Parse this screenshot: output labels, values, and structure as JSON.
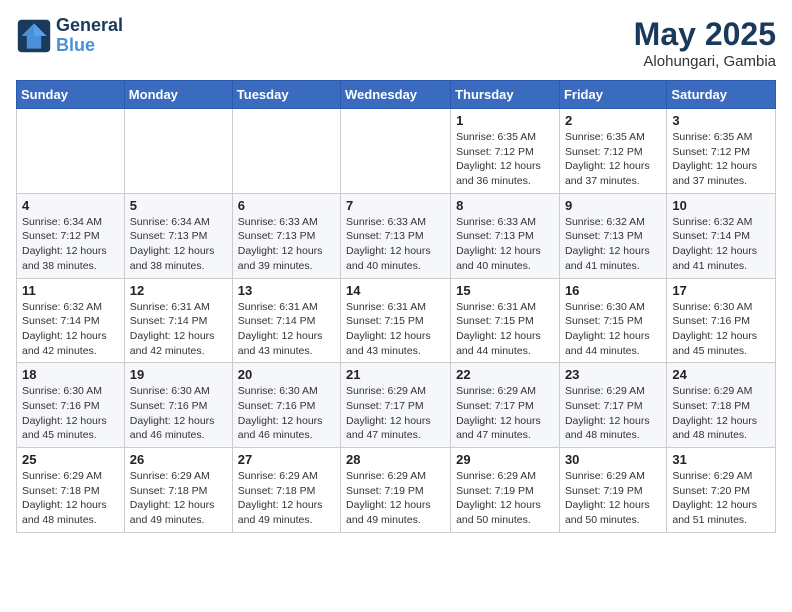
{
  "header": {
    "logo_line1": "General",
    "logo_line2": "Blue",
    "month_year": "May 2025",
    "location": "Alohungari, Gambia"
  },
  "days_of_week": [
    "Sunday",
    "Monday",
    "Tuesday",
    "Wednesday",
    "Thursday",
    "Friday",
    "Saturday"
  ],
  "weeks": [
    [
      {
        "day": "",
        "detail": ""
      },
      {
        "day": "",
        "detail": ""
      },
      {
        "day": "",
        "detail": ""
      },
      {
        "day": "",
        "detail": ""
      },
      {
        "day": "1",
        "detail": "Sunrise: 6:35 AM\nSunset: 7:12 PM\nDaylight: 12 hours and 36 minutes."
      },
      {
        "day": "2",
        "detail": "Sunrise: 6:35 AM\nSunset: 7:12 PM\nDaylight: 12 hours and 37 minutes."
      },
      {
        "day": "3",
        "detail": "Sunrise: 6:35 AM\nSunset: 7:12 PM\nDaylight: 12 hours and 37 minutes."
      }
    ],
    [
      {
        "day": "4",
        "detail": "Sunrise: 6:34 AM\nSunset: 7:12 PM\nDaylight: 12 hours and 38 minutes."
      },
      {
        "day": "5",
        "detail": "Sunrise: 6:34 AM\nSunset: 7:13 PM\nDaylight: 12 hours and 38 minutes."
      },
      {
        "day": "6",
        "detail": "Sunrise: 6:33 AM\nSunset: 7:13 PM\nDaylight: 12 hours and 39 minutes."
      },
      {
        "day": "7",
        "detail": "Sunrise: 6:33 AM\nSunset: 7:13 PM\nDaylight: 12 hours and 40 minutes."
      },
      {
        "day": "8",
        "detail": "Sunrise: 6:33 AM\nSunset: 7:13 PM\nDaylight: 12 hours and 40 minutes."
      },
      {
        "day": "9",
        "detail": "Sunrise: 6:32 AM\nSunset: 7:13 PM\nDaylight: 12 hours and 41 minutes."
      },
      {
        "day": "10",
        "detail": "Sunrise: 6:32 AM\nSunset: 7:14 PM\nDaylight: 12 hours and 41 minutes."
      }
    ],
    [
      {
        "day": "11",
        "detail": "Sunrise: 6:32 AM\nSunset: 7:14 PM\nDaylight: 12 hours and 42 minutes."
      },
      {
        "day": "12",
        "detail": "Sunrise: 6:31 AM\nSunset: 7:14 PM\nDaylight: 12 hours and 42 minutes."
      },
      {
        "day": "13",
        "detail": "Sunrise: 6:31 AM\nSunset: 7:14 PM\nDaylight: 12 hours and 43 minutes."
      },
      {
        "day": "14",
        "detail": "Sunrise: 6:31 AM\nSunset: 7:15 PM\nDaylight: 12 hours and 43 minutes."
      },
      {
        "day": "15",
        "detail": "Sunrise: 6:31 AM\nSunset: 7:15 PM\nDaylight: 12 hours and 44 minutes."
      },
      {
        "day": "16",
        "detail": "Sunrise: 6:30 AM\nSunset: 7:15 PM\nDaylight: 12 hours and 44 minutes."
      },
      {
        "day": "17",
        "detail": "Sunrise: 6:30 AM\nSunset: 7:16 PM\nDaylight: 12 hours and 45 minutes."
      }
    ],
    [
      {
        "day": "18",
        "detail": "Sunrise: 6:30 AM\nSunset: 7:16 PM\nDaylight: 12 hours and 45 minutes."
      },
      {
        "day": "19",
        "detail": "Sunrise: 6:30 AM\nSunset: 7:16 PM\nDaylight: 12 hours and 46 minutes."
      },
      {
        "day": "20",
        "detail": "Sunrise: 6:30 AM\nSunset: 7:16 PM\nDaylight: 12 hours and 46 minutes."
      },
      {
        "day": "21",
        "detail": "Sunrise: 6:29 AM\nSunset: 7:17 PM\nDaylight: 12 hours and 47 minutes."
      },
      {
        "day": "22",
        "detail": "Sunrise: 6:29 AM\nSunset: 7:17 PM\nDaylight: 12 hours and 47 minutes."
      },
      {
        "day": "23",
        "detail": "Sunrise: 6:29 AM\nSunset: 7:17 PM\nDaylight: 12 hours and 48 minutes."
      },
      {
        "day": "24",
        "detail": "Sunrise: 6:29 AM\nSunset: 7:18 PM\nDaylight: 12 hours and 48 minutes."
      }
    ],
    [
      {
        "day": "25",
        "detail": "Sunrise: 6:29 AM\nSunset: 7:18 PM\nDaylight: 12 hours and 48 minutes."
      },
      {
        "day": "26",
        "detail": "Sunrise: 6:29 AM\nSunset: 7:18 PM\nDaylight: 12 hours and 49 minutes."
      },
      {
        "day": "27",
        "detail": "Sunrise: 6:29 AM\nSunset: 7:18 PM\nDaylight: 12 hours and 49 minutes."
      },
      {
        "day": "28",
        "detail": "Sunrise: 6:29 AM\nSunset: 7:19 PM\nDaylight: 12 hours and 49 minutes."
      },
      {
        "day": "29",
        "detail": "Sunrise: 6:29 AM\nSunset: 7:19 PM\nDaylight: 12 hours and 50 minutes."
      },
      {
        "day": "30",
        "detail": "Sunrise: 6:29 AM\nSunset: 7:19 PM\nDaylight: 12 hours and 50 minutes."
      },
      {
        "day": "31",
        "detail": "Sunrise: 6:29 AM\nSunset: 7:20 PM\nDaylight: 12 hours and 51 minutes."
      }
    ]
  ]
}
